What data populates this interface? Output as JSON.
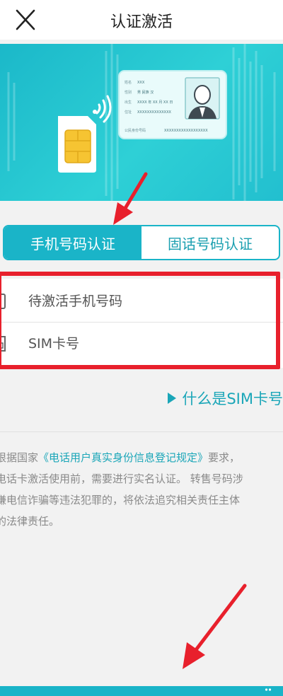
{
  "header": {
    "title": "认证激活",
    "close_icon": "close-icon"
  },
  "banner": {
    "illustration": "sim-card-and-id-card",
    "id_card": {
      "line_1": "姓名  XXX",
      "line_2": "性别  男  民族  汉",
      "line_3": "出生  XXXX 年 XX 月 XX 日",
      "line_4": "住址  XXXXXXXXXXXXXX",
      "id_label": "公民身份号码",
      "id_number": "XXXXXXXXXXXXXXXXXX"
    }
  },
  "tabs": [
    {
      "label": "手机号码认证",
      "active": true
    },
    {
      "label": "固话号码认证",
      "active": false
    }
  ],
  "form": {
    "phone_placeholder": "待激活手机号码",
    "sim_placeholder": "SIM卡号"
  },
  "sim_link": {
    "label": "什么是SIM卡号"
  },
  "notice": {
    "line1_before": "根据国家",
    "law_name": "《电话用户真实身份信息登记规定》",
    "line1_after": "要求，",
    "line2": "电话卡激活使用前，需要进行实名认证。 转售号码涉",
    "line3": "嫌电信诈骗等违法犯罪的，将依法追究相关责任主体",
    "line4": "的法律责任。"
  },
  "colors": {
    "accent": "#1ab4c8",
    "annotation_red": "#e8202c",
    "banner": "#22c4d0"
  }
}
